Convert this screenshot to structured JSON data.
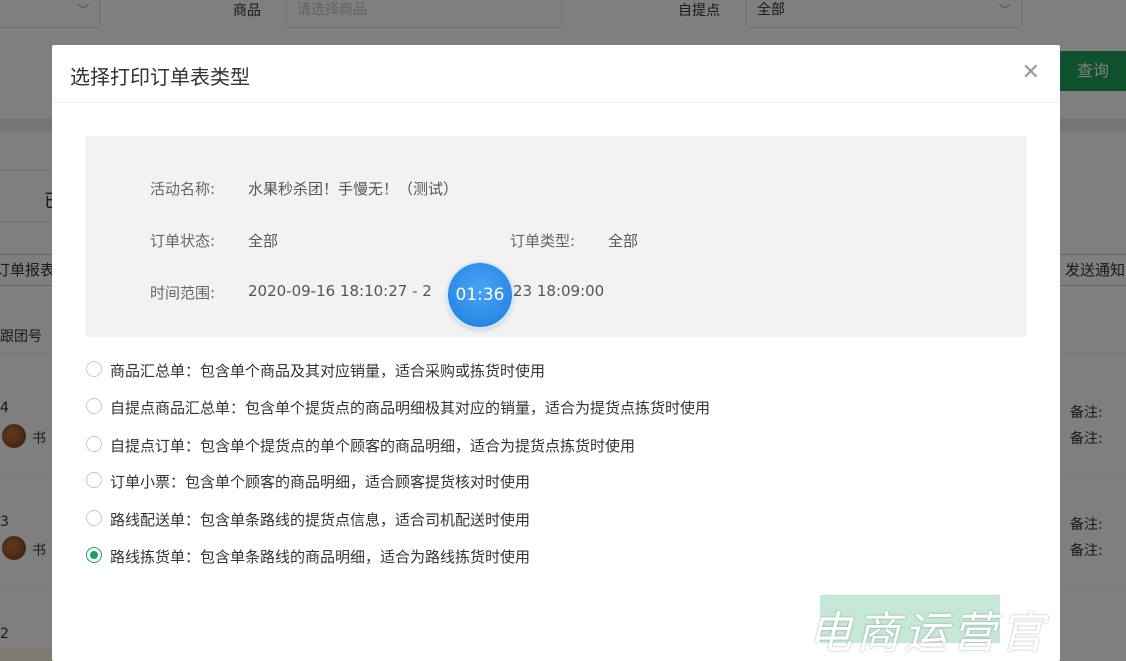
{
  "background": {
    "filter": {
      "product_label": "商品",
      "product_placeholder": "请选择商品",
      "pickup_label": "自提点",
      "pickup_value": "全部",
      "query_button": "查询"
    },
    "tab_text": "已",
    "left_button": "订单报表",
    "right_button": "发送通知",
    "column_header": "跟团号",
    "rows": [
      {
        "num": "4",
        "name": "书",
        "note1": "备注:",
        "note2": "备注:"
      },
      {
        "num": "3",
        "name": "书",
        "note1": "备注:",
        "note2": "备注:"
      },
      {
        "num": "2"
      }
    ]
  },
  "dialog": {
    "title": "选择打印订单表类型",
    "close_icon": "close-icon",
    "info": {
      "activity_label": "活动名称:",
      "activity_value": "水果秒杀团！手慢无！（测试）",
      "status_label": "订单状态:",
      "status_value": "全部",
      "type_label": "订单类型:",
      "type_value": "全部",
      "time_label": "时间范围:",
      "time_start": "2020-09-16 18:10:27 - 2",
      "time_end": "23 18:09:00"
    },
    "timer": "01:36",
    "options": [
      {
        "label": "商品汇总单：包含单个商品及其对应销量，适合采购或拣货时使用",
        "checked": false
      },
      {
        "label": "自提点商品汇总单：包含单个提货点的商品明细极其对应的销量，适合为提货点拣货时使用",
        "checked": false
      },
      {
        "label": "自提点订单：包含单个提货点的单个顾客的商品明细，适合为提货点拣货时使用",
        "checked": false
      },
      {
        "label": "订单小票：包含单个顾客的商品明细，适合顾客提货核对时使用",
        "checked": false
      },
      {
        "label": "路线配送单：包含单条路线的提货点信息，适合司机配送时使用",
        "checked": false
      },
      {
        "label": "路线拣货单：包含单条路线的商品明细，适合为路线拣货时使用",
        "checked": true
      }
    ]
  },
  "watermark": "电商运营官",
  "colors": {
    "accent": "#1aa35a",
    "timer": "#2b8ded"
  }
}
